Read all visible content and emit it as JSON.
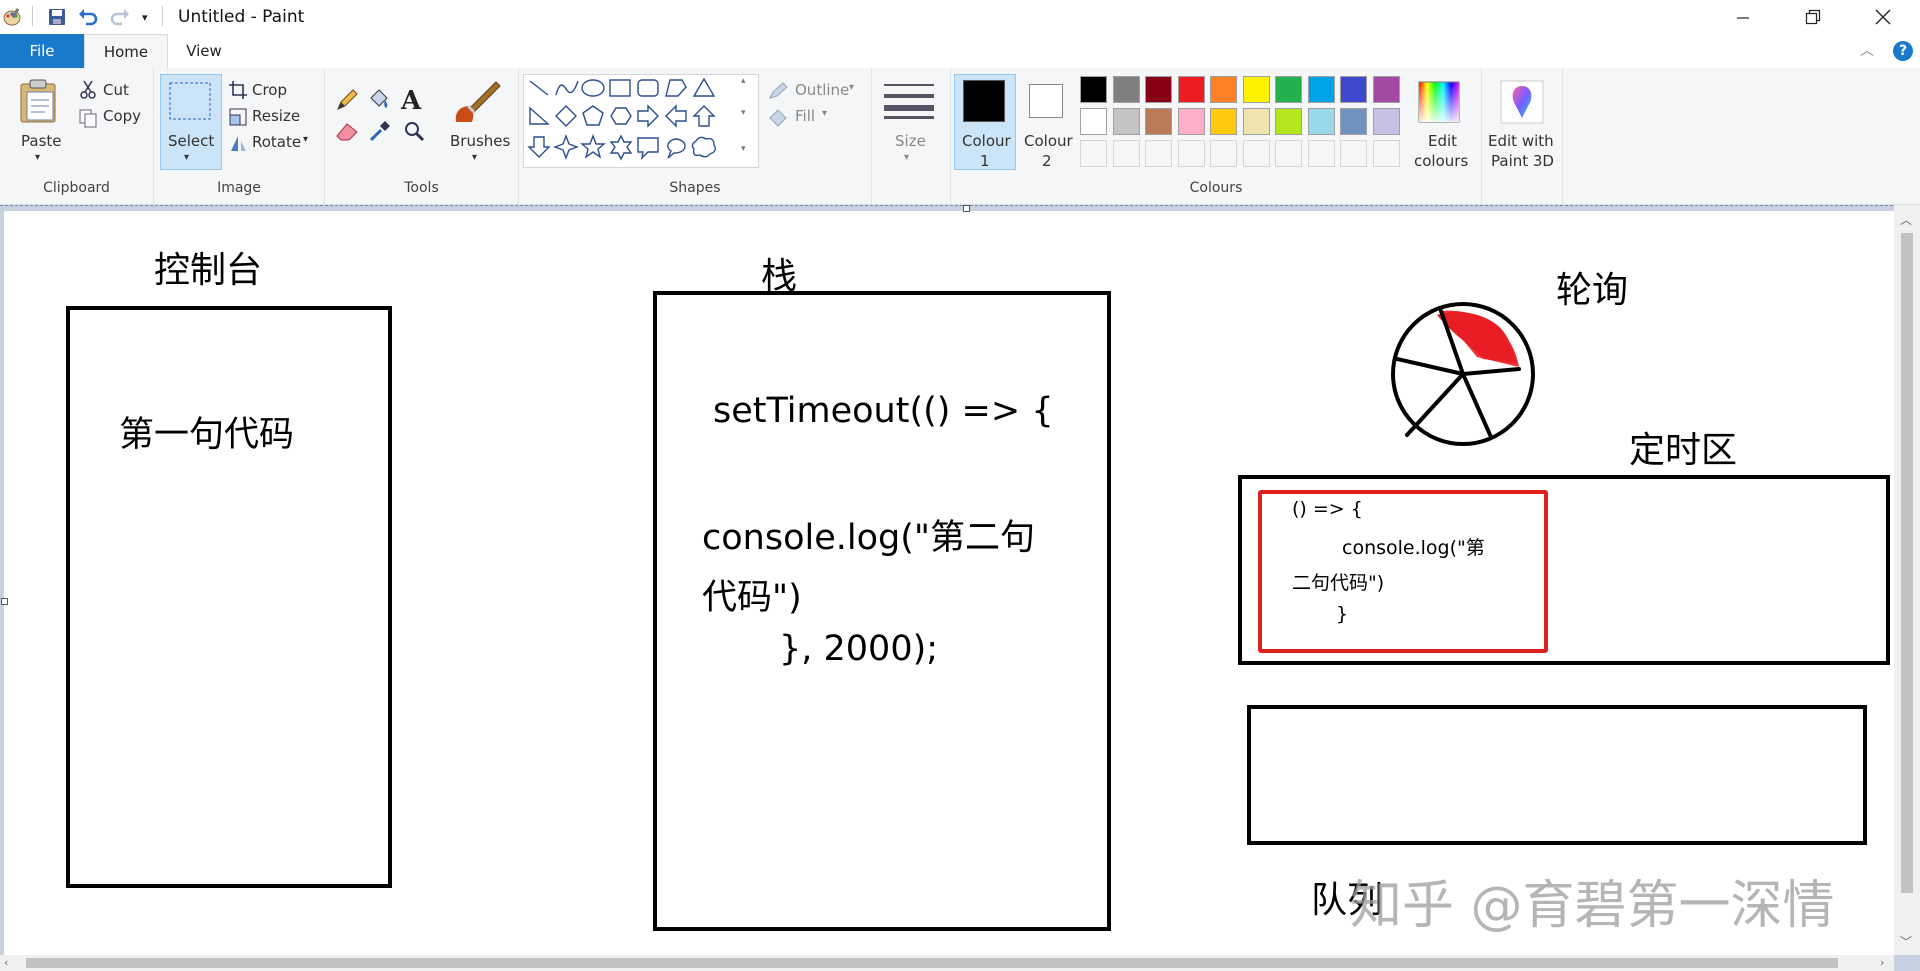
{
  "window": {
    "title": "Untitled - Paint"
  },
  "tabs": [
    {
      "label": "File"
    },
    {
      "label": "Home"
    },
    {
      "label": "View"
    }
  ],
  "ribbon": {
    "clipboard": {
      "group": "Clipboard",
      "paste": "Paste",
      "cut": "Cut",
      "copy": "Copy"
    },
    "image": {
      "group": "Image",
      "select": "Select",
      "crop": "Crop",
      "resize": "Resize",
      "rotate": "Rotate"
    },
    "tools": {
      "group": "Tools"
    },
    "brushes": {
      "label": "Brushes"
    },
    "shapes": {
      "group": "Shapes",
      "outline": "Outline",
      "fill": "Fill"
    },
    "size": {
      "label": "Size"
    },
    "colour1": {
      "label1": "Colour",
      "label2": "1",
      "color": "#000000"
    },
    "colour2": {
      "label1": "Colour",
      "label2": "2",
      "color": "#ffffff"
    },
    "colours": {
      "group": "Colours",
      "row1": [
        "#000000",
        "#7f7f7f",
        "#880015",
        "#ed1c24",
        "#ff7f27",
        "#fff200",
        "#22b14c",
        "#00a2e8",
        "#3f48cc",
        "#a349a4"
      ],
      "row2": [
        "#ffffff",
        "#c3c3c3",
        "#b97a57",
        "#ffaec9",
        "#ffc90e",
        "#efe4b0",
        "#b5e61d",
        "#99d9ea",
        "#7092be",
        "#c8bfe7"
      ]
    },
    "edit_colours": {
      "line1": "Edit",
      "line2": "colours"
    },
    "paint3d": {
      "line1": "Edit with",
      "line2": "Paint 3D"
    }
  },
  "canvas": {
    "console_title": "控制台",
    "console_line": "第一句代码",
    "stack_title": "栈",
    "stack_code": {
      "l1": "setTimeout(() => {",
      "l2": "console.log(\"第二句",
      "l3": "代码\")",
      "l4": "}, 2000);"
    },
    "poll_title": "轮询",
    "timer_title": "定时区",
    "timer_code": {
      "l1": "() => {",
      "l2": "console.log(\"第",
      "l3": "二句代码\")",
      "l4": "}"
    },
    "queue_title": "队列",
    "watermark": "知乎 @育碧第一深情"
  }
}
